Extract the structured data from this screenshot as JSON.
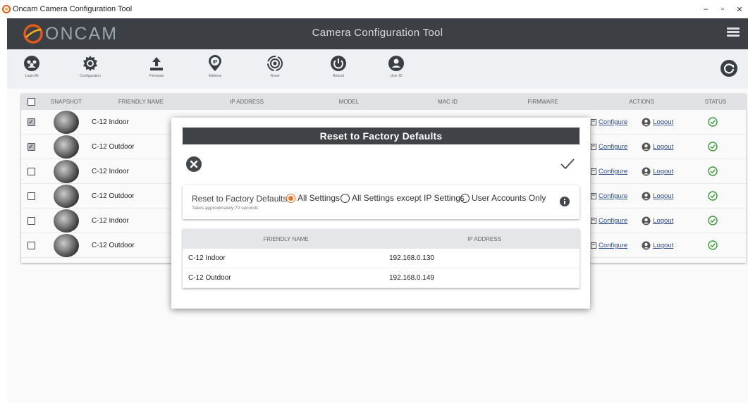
{
  "window": {
    "title": "Oncam Camera Configuration Tool",
    "controls": [
      "–",
      "▫",
      "✕"
    ]
  },
  "header": {
    "brand": "ONCAM",
    "title": "Camera Configuration Tool",
    "brand_color": "#e05a1e"
  },
  "toolbar": {
    "items": [
      {
        "label": "Login All",
        "icon": "login-all-icon"
      },
      {
        "label": "Configuration",
        "icon": "configuration-icon"
      },
      {
        "label": "Firmware",
        "icon": "firmware-upload-icon"
      },
      {
        "label": "Address",
        "icon": "ip-address-icon"
      },
      {
        "label": "Reset",
        "icon": "reset-icon"
      },
      {
        "label": "Reboot",
        "icon": "reboot-power-icon"
      },
      {
        "label": "User ID",
        "icon": "user-id-icon"
      }
    ],
    "refresh_icon": "refresh-icon"
  },
  "table": {
    "columns": [
      "SNAPSHOT",
      "FRIENDLY NAME",
      "IP ADDRESS",
      "MODEL",
      "MAC ID",
      "FIRMWARE",
      "ACTIONS",
      "STATUS"
    ],
    "rows": [
      {
        "checked": true,
        "name": "C-12 Indoor"
      },
      {
        "checked": true,
        "name": "C-12 Outdoor"
      },
      {
        "checked": false,
        "name": "C-12 Indoor"
      },
      {
        "checked": false,
        "name": "C-12 Outdoor"
      },
      {
        "checked": false,
        "name": "C-12 Indoor"
      },
      {
        "checked": false,
        "name": "C-12 Outdoor"
      }
    ],
    "actions": {
      "configure": "Configure",
      "logout": "Logout"
    },
    "status_color": "#3d9a3d"
  },
  "modal": {
    "title": "Reset to Factory Defaults",
    "option_label": "Reset to Factory Defaults",
    "option_sub": "Takes approximately 70 seconds",
    "options": [
      "All Settings",
      "All Settings except IP Settings",
      "User Accounts Only"
    ],
    "selected": "All Settings",
    "accent": "#e8732c",
    "table": {
      "columns": [
        "FRIENDLY NAME",
        "IP ADDRESS"
      ],
      "rows": [
        {
          "name": "C-12 Indoor",
          "ip": "192.168.0.130"
        },
        {
          "name": "C-12 Outdoor",
          "ip": "192.168.0.149"
        }
      ]
    }
  }
}
